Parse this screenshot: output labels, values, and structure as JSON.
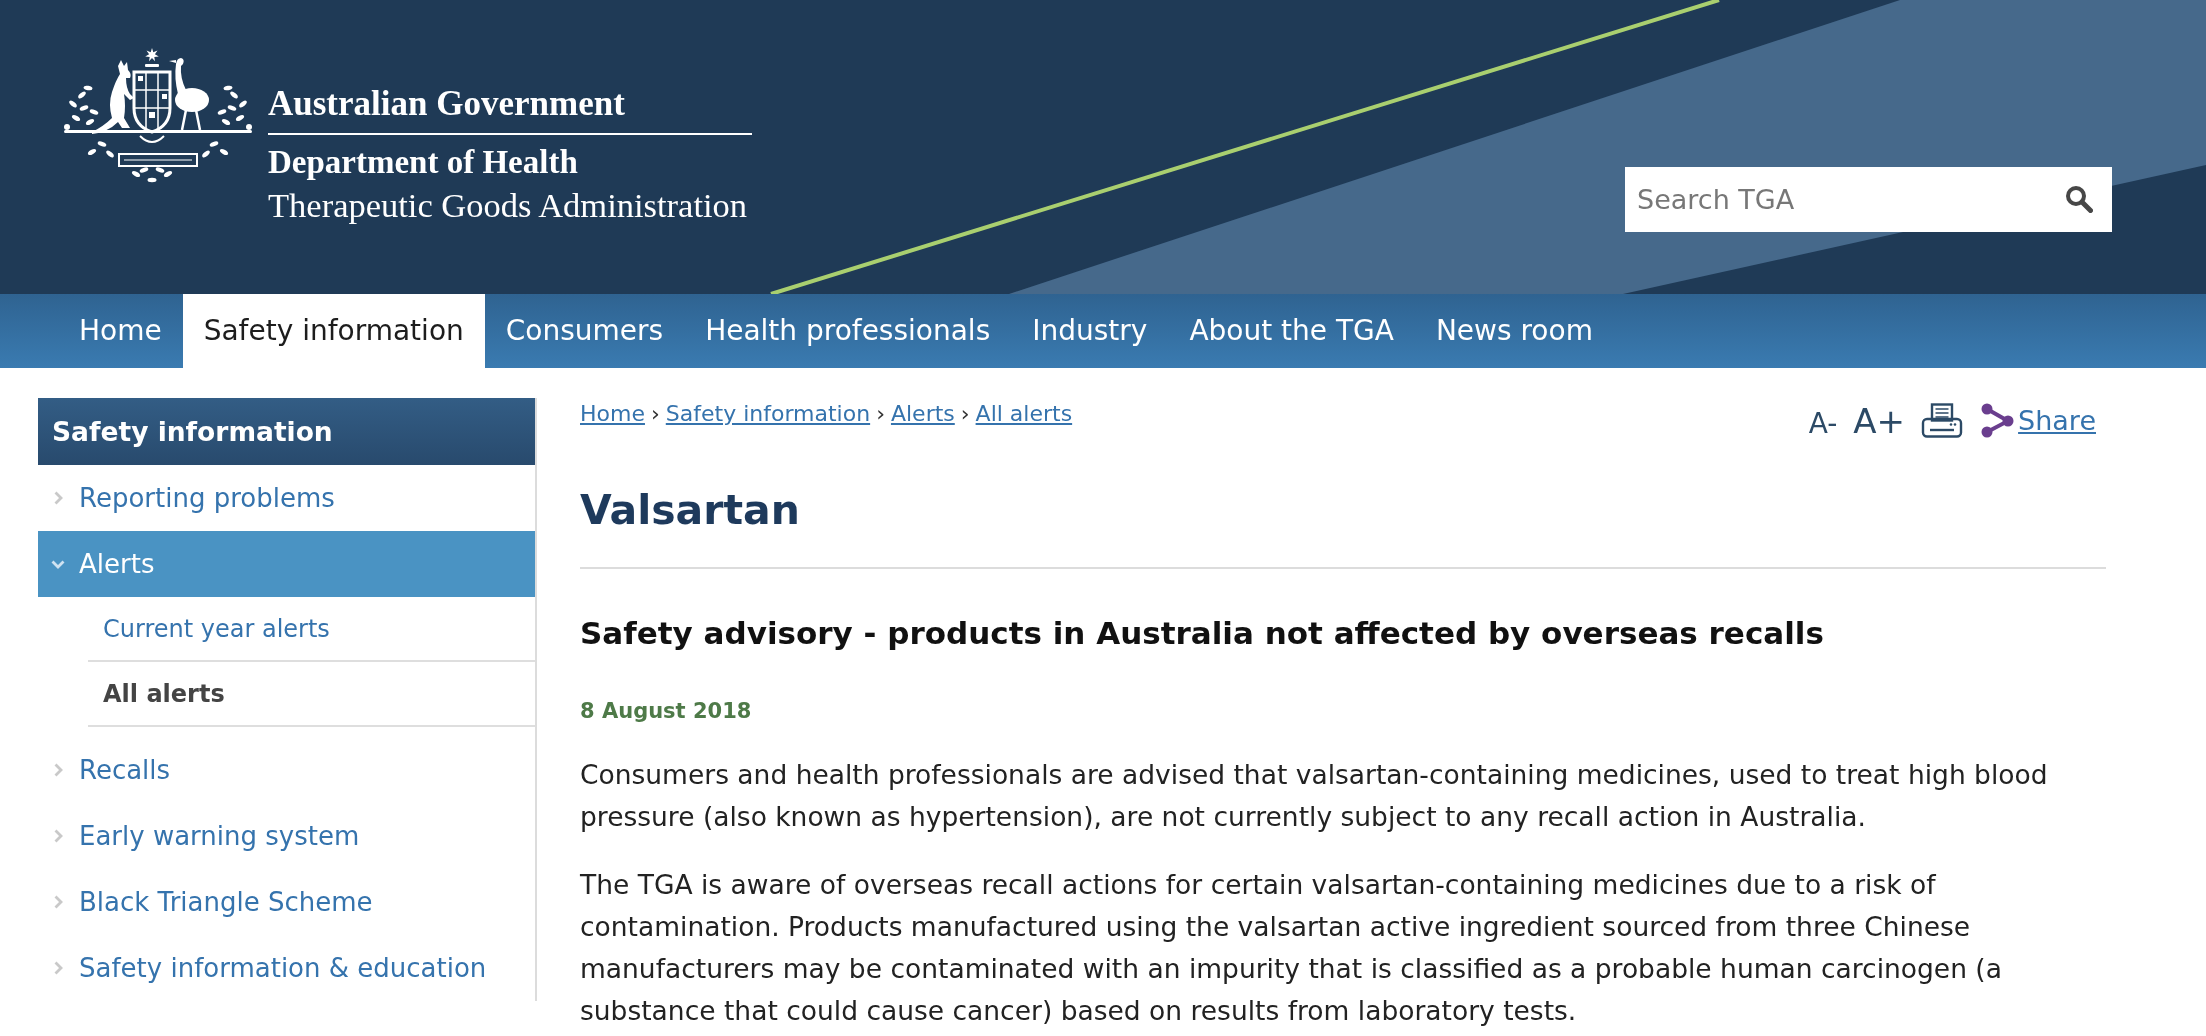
{
  "header": {
    "logo": {
      "government": "Australian Government",
      "department": "Department of Health",
      "agency": "Therapeutic Goods Administration"
    },
    "search": {
      "placeholder": "Search TGA"
    }
  },
  "nav": [
    {
      "label": "Home",
      "selected": false
    },
    {
      "label": "Safety information",
      "selected": true
    },
    {
      "label": "Consumers",
      "selected": false
    },
    {
      "label": "Health professionals",
      "selected": false
    },
    {
      "label": "Industry",
      "selected": false
    },
    {
      "label": "About the TGA",
      "selected": false
    },
    {
      "label": "News room",
      "selected": false
    }
  ],
  "sidebar": {
    "title": "Safety information",
    "items": [
      {
        "label": "Reporting problems",
        "expanded": false,
        "selected": false
      },
      {
        "label": "Alerts",
        "expanded": true,
        "selected": true,
        "children": [
          {
            "label": "Current year alerts",
            "selected": false
          },
          {
            "label": "All alerts",
            "selected": true
          }
        ]
      },
      {
        "label": "Recalls",
        "expanded": false,
        "selected": false
      },
      {
        "label": "Early warning system",
        "expanded": false,
        "selected": false
      },
      {
        "label": "Black Triangle Scheme",
        "expanded": false,
        "selected": false
      },
      {
        "label": "Safety information & education",
        "expanded": false,
        "selected": false
      }
    ]
  },
  "breadcrumb": [
    {
      "label": "Home",
      "separator": "›"
    },
    {
      "label": "Safety information",
      "separator": "›"
    },
    {
      "label": "Alerts",
      "separator": "›"
    },
    {
      "label": "All alerts"
    }
  ],
  "page_tools": {
    "text_size": [
      {
        "label": "A-",
        "kind": "decrease"
      },
      {
        "label": "A+",
        "kind": "increase"
      }
    ],
    "share": "Share"
  },
  "article": {
    "title": "Valsartan",
    "subtitle": "Safety advisory - products in Australia not affected by overseas recalls",
    "date": "8 August 2018",
    "paragraphs": [
      "Consumers and health professionals are advised that valsartan-containing medicines, used to treat high blood pressure (also known as hypertension), are not currently subject to any recall action in Australia.",
      "The TGA is aware of overseas recall actions for certain valsartan-containing medicines due to a risk of contamination. Products manufactured using the valsartan active ingredient sourced from three Chinese manufacturers may be contaminated with an impurity that is classified as a probable human carcinogen (a substance that could cause cancer) based on results from laboratory tests."
    ]
  }
}
